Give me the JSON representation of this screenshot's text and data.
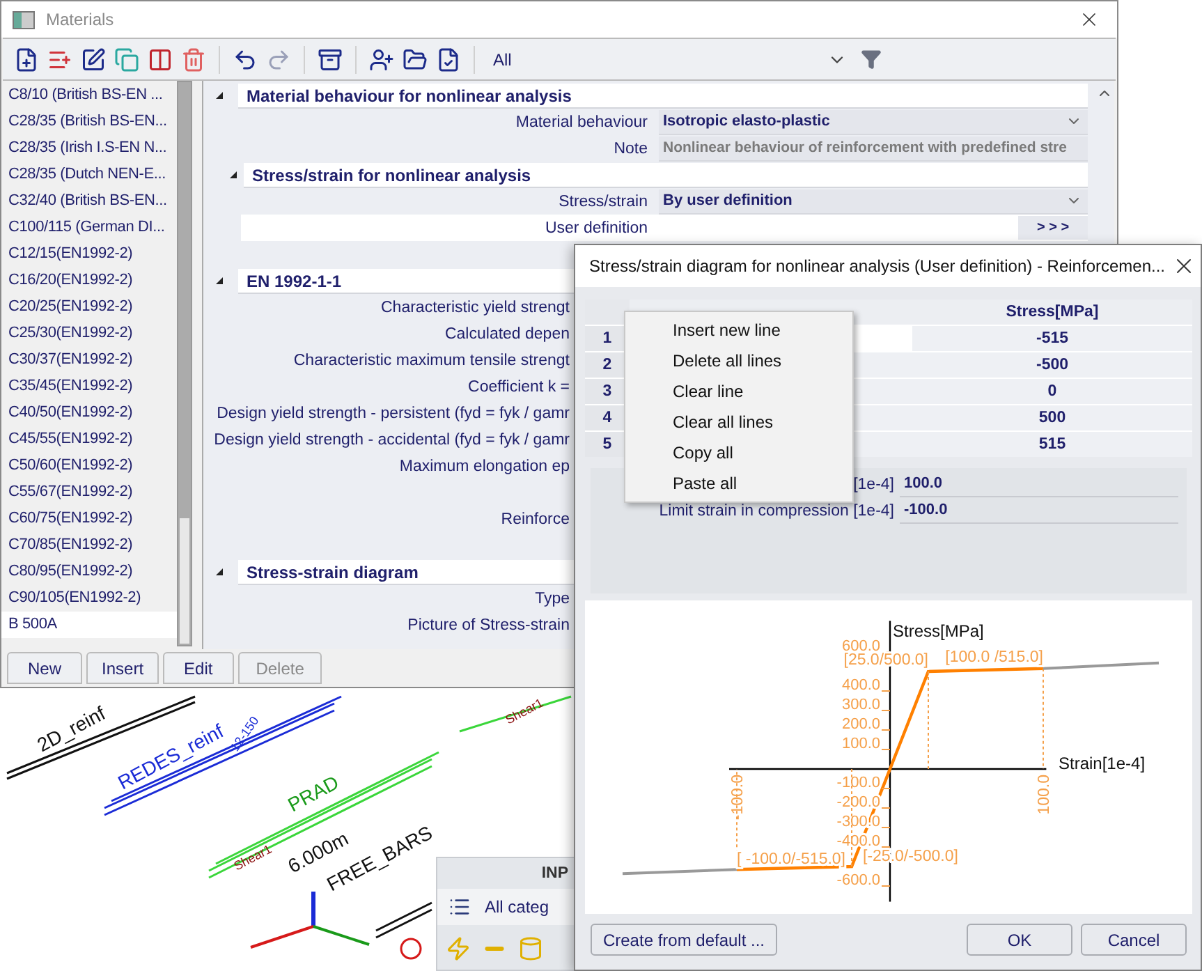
{
  "materials_window": {
    "title": "Materials",
    "filter": {
      "value": "All"
    },
    "materials": [
      {
        "name": "C8/10 (British BS-EN ...",
        "selected": false
      },
      {
        "name": "C28/35 (British BS-EN...",
        "selected": false
      },
      {
        "name": "C28/35 (Irish I.S-EN N...",
        "selected": false
      },
      {
        "name": "C28/35 (Dutch NEN-E...",
        "selected": false
      },
      {
        "name": "C32/40 (British BS-EN...",
        "selected": false
      },
      {
        "name": "C100/115 (German DI...",
        "selected": false
      },
      {
        "name": "C12/15(EN1992-2)",
        "selected": false
      },
      {
        "name": "C16/20(EN1992-2)",
        "selected": false
      },
      {
        "name": "C20/25(EN1992-2)",
        "selected": false
      },
      {
        "name": "C25/30(EN1992-2)",
        "selected": false
      },
      {
        "name": "C30/37(EN1992-2)",
        "selected": false
      },
      {
        "name": "C35/45(EN1992-2)",
        "selected": false
      },
      {
        "name": "C40/50(EN1992-2)",
        "selected": false
      },
      {
        "name": "C45/55(EN1992-2)",
        "selected": false
      },
      {
        "name": "C50/60(EN1992-2)",
        "selected": false
      },
      {
        "name": "C55/67(EN1992-2)",
        "selected": false
      },
      {
        "name": "C60/75(EN1992-2)",
        "selected": false
      },
      {
        "name": "C70/85(EN1992-2)",
        "selected": false
      },
      {
        "name": "C80/95(EN1992-2)",
        "selected": false
      },
      {
        "name": "C90/105(EN1992-2)",
        "selected": false
      },
      {
        "name": "B 500A",
        "selected": true
      }
    ],
    "sections": [
      {
        "title": "Material behaviour for nonlinear analysis",
        "expanded": true,
        "rows": [
          {
            "kind": "dropdown",
            "label": "Material behaviour",
            "value": "Isotropic elasto-plastic"
          },
          {
            "kind": "readonly",
            "label": "Note",
            "value": "Nonlinear behaviour of reinforcement with predefined stre"
          }
        ],
        "children": [
          {
            "title": "Stress/strain for nonlinear analysis",
            "expanded": true,
            "rows": [
              {
                "kind": "dropdown",
                "label": "Stress/strain",
                "value": "By user definition"
              },
              {
                "kind": "button",
                "label": "User definition",
                "value": "> > >"
              },
              {
                "kind": "blank"
              }
            ]
          }
        ]
      },
      {
        "title": "EN 1992-1-1",
        "expanded": true,
        "rows": [
          {
            "kind": "hidden",
            "label": "Characteristic yield strengt"
          },
          {
            "kind": "hidden",
            "label": "Calculated depen"
          },
          {
            "kind": "hidden",
            "label": "Characteristic maximum tensile strengt"
          },
          {
            "kind": "hidden",
            "label": "Coefficient k ="
          },
          {
            "kind": "hidden",
            "label": "Design yield strength - persistent (fyd = fyk / gamr"
          },
          {
            "kind": "hidden",
            "label": "Design yield strength - accidental (fyd = fyk / gamr"
          },
          {
            "kind": "hidden",
            "label": "Maximum elongation ep"
          },
          {
            "kind": "blank"
          },
          {
            "kind": "hidden",
            "label": "Reinforce"
          },
          {
            "kind": "blank"
          }
        ]
      },
      {
        "title": "Stress-strain diagram",
        "expanded": true,
        "rows": [
          {
            "kind": "hidden",
            "label": "Type"
          },
          {
            "kind": "hidden",
            "label": "Picture of Stress-strain"
          }
        ]
      }
    ],
    "buttons": [
      {
        "label": "New",
        "disabled": false
      },
      {
        "label": "Insert",
        "disabled": false
      },
      {
        "label": "Edit",
        "disabled": false
      },
      {
        "label": "Delete",
        "disabled": true
      }
    ]
  },
  "dialog": {
    "title": "Stress/strain diagram for nonlinear analysis (User definition) - Reinforcemen...",
    "table": {
      "stress_header": "Stress[MPa]",
      "rows": [
        {
          "number": "1",
          "stress": "-515",
          "selected": true
        },
        {
          "number": "2",
          "stress": "-500",
          "selected": false
        },
        {
          "number": "3",
          "stress": "0",
          "selected": false
        },
        {
          "number": "4",
          "stress": "500",
          "selected": false
        },
        {
          "number": "5",
          "stress": "515",
          "selected": false
        }
      ]
    },
    "context_menu": [
      "Insert new line",
      "Delete all lines",
      "Clear line",
      "Clear all lines",
      "Copy all",
      "Paste all"
    ],
    "limits": [
      {
        "label": "[1e-4]",
        "value": "100.0"
      },
      {
        "label": "Limit strain in compression [1e-4]",
        "value": "-100.0"
      }
    ],
    "chart_data": {
      "type": "line",
      "xlabel": "Strain[1e-4]",
      "ylabel": "Stress[MPa]",
      "x": [
        -100,
        -25,
        0,
        25,
        100
      ],
      "series": [
        {
          "color": "#ff8000",
          "values": [
            -515,
            -500,
            0,
            500,
            515
          ]
        }
      ],
      "xlim": [
        -105,
        102
      ],
      "ylim": [
        -680,
        760
      ],
      "xticks": [
        {
          "value": -100,
          "label": "-100.0"
        },
        {
          "value": 100,
          "label": "100.0"
        }
      ],
      "yticks": [
        {
          "value": 600,
          "label": "600.0"
        },
        {
          "value": 400,
          "label": "400.0"
        },
        {
          "value": 300,
          "label": "300.0"
        },
        {
          "value": 200,
          "label": "200.0"
        },
        {
          "value": 100,
          "label": "100.0"
        },
        {
          "value": -100,
          "label": "-100.0"
        },
        {
          "value": -200,
          "label": "-200.0"
        },
        {
          "value": -300,
          "label": "-300.0"
        },
        {
          "value": -400,
          "label": "-400.0"
        },
        {
          "value": -600,
          "label": "-600.0"
        }
      ],
      "annotations": [
        {
          "x": -100,
          "y": -515,
          "text": "[ -100.0/-515.0]"
        },
        {
          "x": -25,
          "y": -500,
          "text": "[-25.0/-500.0]"
        },
        {
          "x": 25,
          "y": 500,
          "text": "[25.0/500.0]"
        },
        {
          "x": 100,
          "y": 515,
          "text": "[100.0 /515.0]"
        }
      ]
    },
    "buttons": [
      {
        "label": "Create from default ..."
      },
      {
        "label": "OK"
      },
      {
        "label": "Cancel"
      }
    ]
  },
  "model": {
    "labels": [
      "2D_reinf",
      "REDES_reinf",
      "12-150",
      "PRAD",
      "Shear1",
      "6.000m",
      "FREE_BARS",
      "Shear1"
    ],
    "panel": {
      "title": "INP",
      "category": "All categ"
    }
  }
}
